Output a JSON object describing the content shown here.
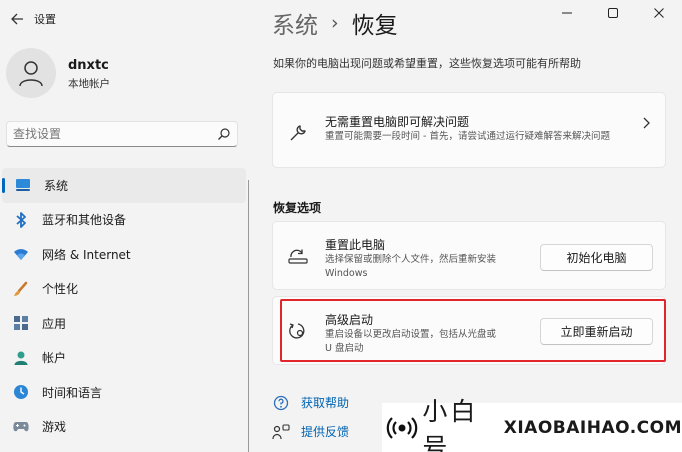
{
  "app": {
    "title": "设置"
  },
  "window_controls": {
    "minimize": "–",
    "maximize": "□",
    "close": "✕"
  },
  "user": {
    "name": "dnxtc",
    "account_type": "本地帐户"
  },
  "search": {
    "placeholder": "查找设置"
  },
  "nav": {
    "items": [
      {
        "label": "系统",
        "icon": "monitor-icon",
        "active": true
      },
      {
        "label": "蓝牙和其他设备",
        "icon": "bluetooth-icon"
      },
      {
        "label": "网络 & Internet",
        "icon": "wifi-icon"
      },
      {
        "label": "个性化",
        "icon": "brush-icon"
      },
      {
        "label": "应用",
        "icon": "apps-icon"
      },
      {
        "label": "帐户",
        "icon": "person-icon"
      },
      {
        "label": "时间和语言",
        "icon": "clock-icon"
      },
      {
        "label": "游戏",
        "icon": "gamepad-icon"
      }
    ]
  },
  "breadcrumb": {
    "parent": "系统",
    "separator": "›",
    "current": "恢复"
  },
  "intro": "如果你的电脑出现问题或希望重置，这些恢复选项可能有所帮助",
  "troubleshoot": {
    "title": "无需重置电脑即可解决问题",
    "description": "重置可能需要一段时间 - 首先，请尝试通过运行疑难解答来解决问题",
    "icon": "wrench-icon"
  },
  "recovery_section": {
    "title": "恢复选项"
  },
  "reset_pc": {
    "title": "重置此电脑",
    "description_line1": "选择保留或删除个人文件，然后重新安装",
    "description_line2": "Windows",
    "button": "初始化电脑",
    "icon": "reset-pc-icon"
  },
  "advanced_startup": {
    "title": "高级启动",
    "description_line1": "重启设备以更改启动设置，包括从光盘或",
    "description_line2": "U 盘启动",
    "button": "立即重新启动",
    "icon": "restart-gear-icon"
  },
  "links": {
    "help": "获取帮助",
    "feedback": "提供反馈"
  },
  "watermark": {
    "cn": "小白号",
    "en": "XIAOBAIHAO.COM"
  },
  "colors": {
    "accent": "#0067c0",
    "highlight": "#e0262b",
    "link": "#0063b1"
  }
}
